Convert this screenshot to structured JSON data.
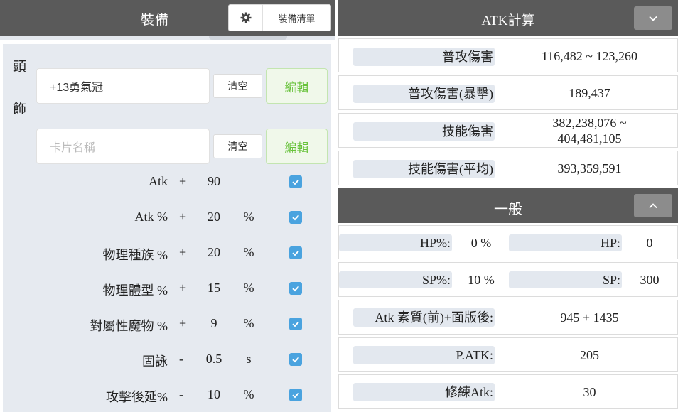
{
  "equip": {
    "title": "裝備",
    "list_button": "裝備清單",
    "slot_chars": [
      "頭",
      "飾"
    ],
    "item_value": "+13勇氣冠",
    "card_placeholder": "卡片名稱",
    "clear_label": "清空",
    "edit_label": "編輯",
    "stats": [
      {
        "label": "Atk",
        "op": "+",
        "value": "90",
        "unit": "",
        "checked": true
      },
      {
        "label": "Atk %",
        "op": "+",
        "value": "20",
        "unit": "%",
        "checked": true
      },
      {
        "label": "物理種族 %",
        "op": "+",
        "value": "20",
        "unit": "%",
        "checked": true
      },
      {
        "label": "物理體型 %",
        "op": "+",
        "value": "15",
        "unit": "%",
        "checked": true
      },
      {
        "label": "對屬性魔物 %",
        "op": "+",
        "value": "9",
        "unit": "%",
        "checked": true
      },
      {
        "label": "固詠",
        "op": "-",
        "value": "0.5",
        "unit": "s",
        "checked": true
      },
      {
        "label": "攻擊後延%",
        "op": "-",
        "value": "10",
        "unit": "%",
        "checked": true
      }
    ]
  },
  "atk": {
    "title": "ATK計算",
    "rows": [
      {
        "label": "普攻傷害",
        "value": "116,482 ~ 123,260"
      },
      {
        "label": "普攻傷害(暴擊)",
        "value": "189,437"
      },
      {
        "label": "技能傷害",
        "value_line1": "382,238,076 ~",
        "value_line2": "404,481,105"
      },
      {
        "label": "技能傷害(平均)",
        "value": "393,359,591"
      }
    ]
  },
  "general": {
    "title": "一般",
    "hp_pct_label": "HP%:",
    "hp_pct_value": "0 %",
    "hp_label": "HP:",
    "hp_value": "0",
    "sp_pct_label": "SP%:",
    "sp_pct_value": "10 %",
    "sp_label": "SP:",
    "sp_value": "300",
    "rows": [
      {
        "label": "Atk 素質(前)+面版後:",
        "value": "945 + 1435"
      },
      {
        "label": "P.ATK:",
        "value": "205"
      },
      {
        "label": "修練Atk:",
        "value": "30"
      }
    ]
  },
  "colors": {
    "header_bg": "#5a5a5a",
    "checkbox": "#4aa3df",
    "edit_green": "#67c23a",
    "label_bg": "#e3e8ef"
  },
  "icons": {
    "list_button": "gear-icon",
    "atk_toggle": "chevron-down-icon",
    "general_toggle": "chevron-up-icon",
    "stat_checkbox": "check-icon"
  }
}
